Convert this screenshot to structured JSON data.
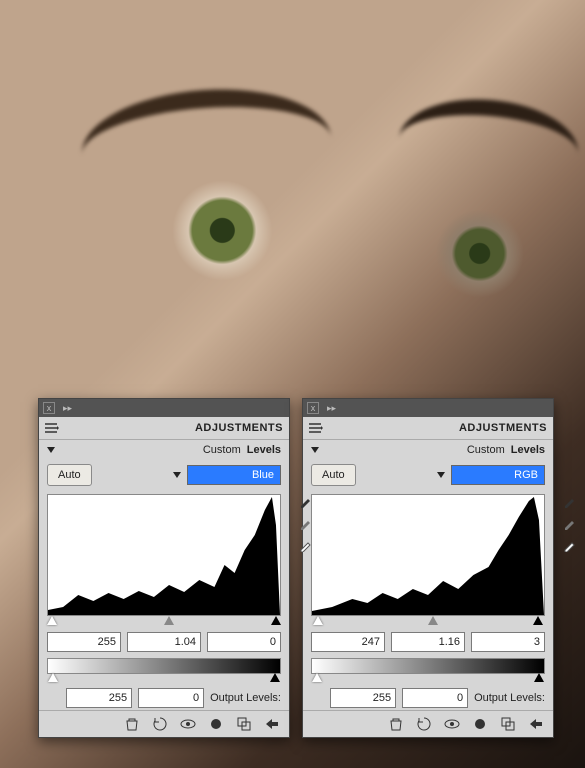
{
  "panels": [
    {
      "title": "ADJUSTMENTS",
      "adjustment_label": "Levels",
      "preset": "Custom",
      "channel": "Blue",
      "auto_label": "Auto",
      "input_black": "0",
      "input_gamma": "1.04",
      "input_white": "255",
      "output_label": "Output Levels:",
      "output_black": "0",
      "output_white": "255",
      "tri_black_pct": 100,
      "tri_gray_pct": 50,
      "tri_white_pct": 0
    },
    {
      "title": "ADJUSTMENTS",
      "adjustment_label": "Levels",
      "preset": "Custom",
      "channel": "RGB",
      "auto_label": "Auto",
      "input_black": "3",
      "input_gamma": "1.16",
      "input_white": "247",
      "output_label": "Output Levels:",
      "output_black": "0",
      "output_white": "255",
      "tri_black_pct": 99,
      "tri_gray_pct": 50,
      "tri_white_pct": 1
    }
  ],
  "icons": {
    "close": "x",
    "collapse": "▸▸"
  }
}
